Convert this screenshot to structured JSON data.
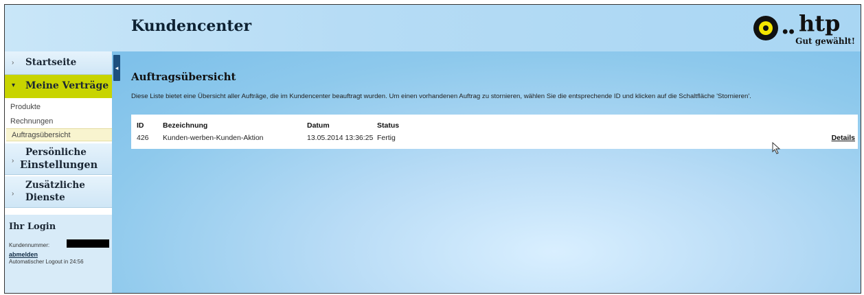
{
  "header": {
    "title": "Kundencenter",
    "logo_brand": "htp",
    "logo_dots": "••",
    "logo_slogan": "Gut gewählt!",
    "accent_color": "#f4e500"
  },
  "sidebar": {
    "startseite": "Startseite",
    "meine_vertraege": "Meine Verträge",
    "subitems": [
      "Produkte",
      "Rechnungen",
      "Auftragsübersicht"
    ],
    "persoenliche_line1": "Persönliche",
    "persoenliche_line2": "Einstellungen",
    "zusaetzliche_line1": "Zusätzliche",
    "zusaetzliche_line2": "Dienste",
    "active_color": "#c8d400"
  },
  "login": {
    "title": "Ihr Login",
    "kundennummer_label": "Kundennummer:",
    "abmelden": "abmelden",
    "logout_text": "Automatischer Logout in 24:56"
  },
  "content": {
    "title": "Auftragsübersicht",
    "description": "Diese Liste bietet eine Übersicht aller Aufträge, die im Kundencenter beauftragt wurden. Um einen vorhandenen Auftrag zu stornieren, wählen Sie die entsprechende ID und klicken auf die Schaltfläche 'Stornieren'.",
    "table": {
      "headers": [
        "ID",
        "Bezeichnung",
        "Datum",
        "Status"
      ],
      "rows": [
        {
          "id": "426",
          "bezeichnung": "Kunden-werben-Kunden-Aktion",
          "datum": "13.05.2014 13:36:25",
          "status": "Fertig",
          "action": "Details"
        }
      ]
    }
  }
}
